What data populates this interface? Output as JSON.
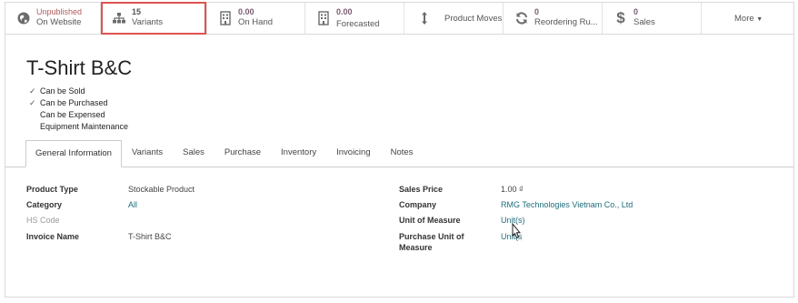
{
  "buttons": {
    "website": {
      "value": "Unpublished",
      "label": "On Website",
      "icon": "globe-icon"
    },
    "variants": {
      "value": "15",
      "label": "Variants",
      "icon": "sitemap-icon"
    },
    "on_hand": {
      "value": "0.00",
      "label": "On Hand",
      "icon": "building-icon"
    },
    "forecasted": {
      "value": "0.00",
      "label": "Forecasted",
      "icon": "building-icon"
    },
    "product_moves": {
      "label": "Product Moves",
      "icon": "arrows-v-icon"
    },
    "reordering": {
      "value": "0",
      "label": "Reordering Ru...",
      "icon": "refresh-icon"
    },
    "sales": {
      "value": "0",
      "label": "Sales",
      "icon": "dollar-icon"
    },
    "more": {
      "label": "More"
    }
  },
  "product": {
    "name": "T-Shirt B&C",
    "flags": [
      {
        "label": "Can be Sold",
        "checked": true
      },
      {
        "label": "Can be Purchased",
        "checked": true
      },
      {
        "label": "Can be Expensed",
        "checked": false
      },
      {
        "label": "Equipment Maintenance",
        "checked": false
      }
    ]
  },
  "tabs": [
    "General Information",
    "Variants",
    "Sales",
    "Purchase",
    "Inventory",
    "Invoicing",
    "Notes"
  ],
  "left_fields": {
    "product_type": {
      "label": "Product Type",
      "value": "Stockable Product"
    },
    "category": {
      "label": "Category",
      "value": "All"
    },
    "hs_code": {
      "label": "HS Code",
      "value": ""
    },
    "invoice_name": {
      "label": "Invoice Name",
      "value": "T-Shirt B&C"
    }
  },
  "right_fields": {
    "sales_price": {
      "label": "Sales Price",
      "value": "1.00 ₫"
    },
    "company": {
      "label": "Company",
      "value": "RMG Technologies Vietnam Co., Ltd"
    },
    "uom": {
      "label": "Unit of Measure",
      "value": "Unit(s)"
    },
    "purchase_uom_line1": {
      "label": "Purchase Unit of",
      "value": "Unit(s)"
    },
    "purchase_uom_line2": {
      "label": "Measure"
    }
  },
  "colors": {
    "accent": "#1d6d7b",
    "highlight": "#e05252"
  }
}
